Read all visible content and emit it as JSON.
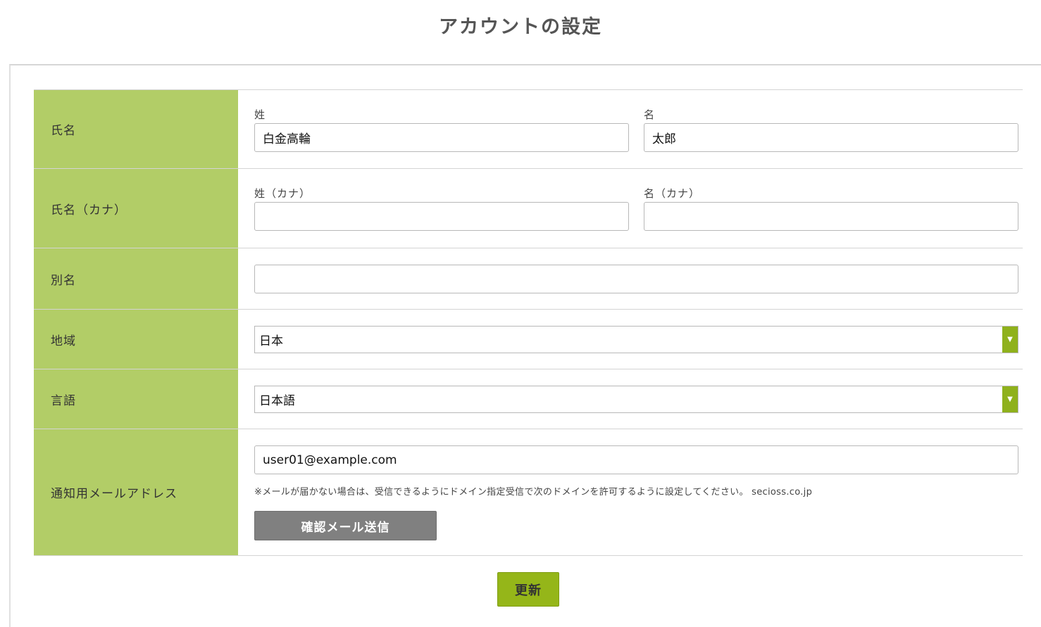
{
  "page": {
    "title": "アカウントの設定"
  },
  "rows": {
    "name": {
      "label": "氏名",
      "last": {
        "label": "姓",
        "value": "白金高輪"
      },
      "first": {
        "label": "名",
        "value": "太郎"
      }
    },
    "kana": {
      "label": "氏名（カナ）",
      "last": {
        "label": "姓（カナ）",
        "value": ""
      },
      "first": {
        "label": "名（カナ）",
        "value": ""
      }
    },
    "alias": {
      "label": "別名",
      "value": ""
    },
    "region": {
      "label": "地域",
      "selected": "日本"
    },
    "language": {
      "label": "言語",
      "selected": "日本語"
    },
    "email": {
      "label": "通知用メールアドレス",
      "value": "user01@example.com",
      "note": "※メールが届かない場合は、受信できるようにドメイン指定受信で次のドメインを許可するように設定してください。 secioss.co.jp",
      "confirm_button": "確認メール送信"
    }
  },
  "actions": {
    "update_button": "更新"
  },
  "icons": {
    "select_arrow": "chevron-down-icon"
  },
  "colors": {
    "label_bg": "#b2cd67",
    "accent_green": "#95b619",
    "confirm_button_bg": "#808080"
  }
}
